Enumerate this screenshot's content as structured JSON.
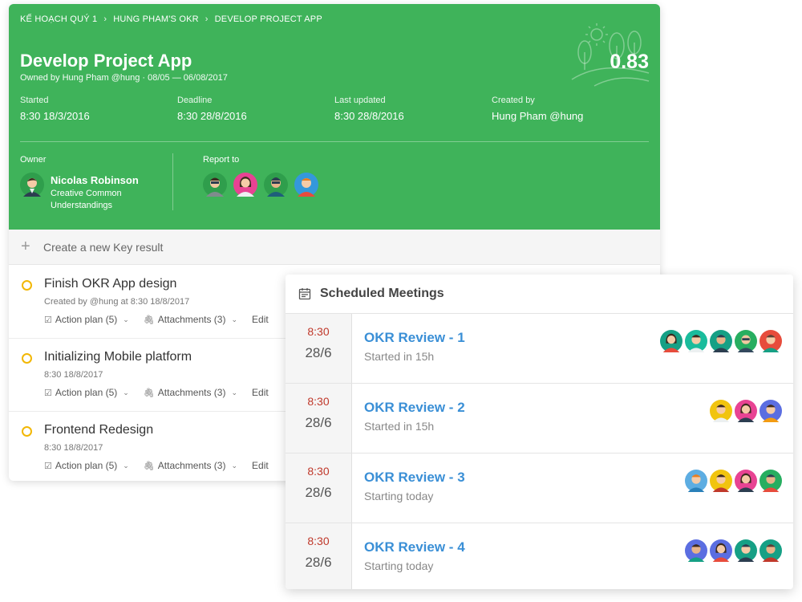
{
  "okr": {
    "breadcrumbs": [
      "KẾ HOẠCH QUÝ 1",
      "HUNG PHAM'S OKR",
      "DEVELOP PROJECT APP"
    ],
    "breadcrumb_sep": "›",
    "title": "Develop Project App",
    "subtitle": "Owned by Hung Pham @hung · 08/05 — 06/08/2017",
    "score": "0.83",
    "meta": [
      {
        "label": "Started",
        "value": "8:30 18/3/2016"
      },
      {
        "label": "Deadline",
        "value": "8:30 28/8/2016"
      },
      {
        "label": "Last updated",
        "value": "8:30 28/8/2016"
      },
      {
        "label": "Created by",
        "value": "Hung Pham @hung"
      }
    ],
    "owner_label": "Owner",
    "owner_name": "Nicolas Robinson",
    "owner_role": "Creative Common Understandings",
    "report_label": "Report to",
    "header_color": "#3fb35a"
  },
  "new_kr": {
    "plus": "+",
    "label": "Create a new Key result"
  },
  "key_results": [
    {
      "name": "Finish OKR App design",
      "meta": "Created by @hung at 8:30 18/8/2017",
      "action": "Action plan (5)",
      "attach": "Attachments (3)",
      "edit": "Edit"
    },
    {
      "name": "Initializing Mobile platform",
      "meta": "8:30 18/8/2017",
      "action": "Action plan (5)",
      "attach": "Attachments (3)",
      "edit": "Edit"
    },
    {
      "name": "Frontend Redesign",
      "meta": "8:30 18/8/2017",
      "action": "Action plan (5)",
      "attach": "Attachments (3)",
      "edit": "Edit"
    }
  ],
  "meetings": {
    "title": "Scheduled Meetings",
    "items": [
      {
        "time": "8:30",
        "date": "28/6",
        "name": "OKR Review - 1",
        "status": "Started in 15h"
      },
      {
        "time": "8:30",
        "date": "28/6",
        "name": "OKR Review - 2",
        "status": "Started in 15h"
      },
      {
        "time": "8:30",
        "date": "28/6",
        "name": "OKR Review - 3",
        "status": "Starting today"
      },
      {
        "time": "8:30",
        "date": "28/6",
        "name": "OKR Review - 4",
        "status": "Starting today"
      }
    ]
  },
  "icons": {
    "check": "☑",
    "clip": "🖇",
    "chev": "⌄",
    "cal": "calendar-icon"
  }
}
